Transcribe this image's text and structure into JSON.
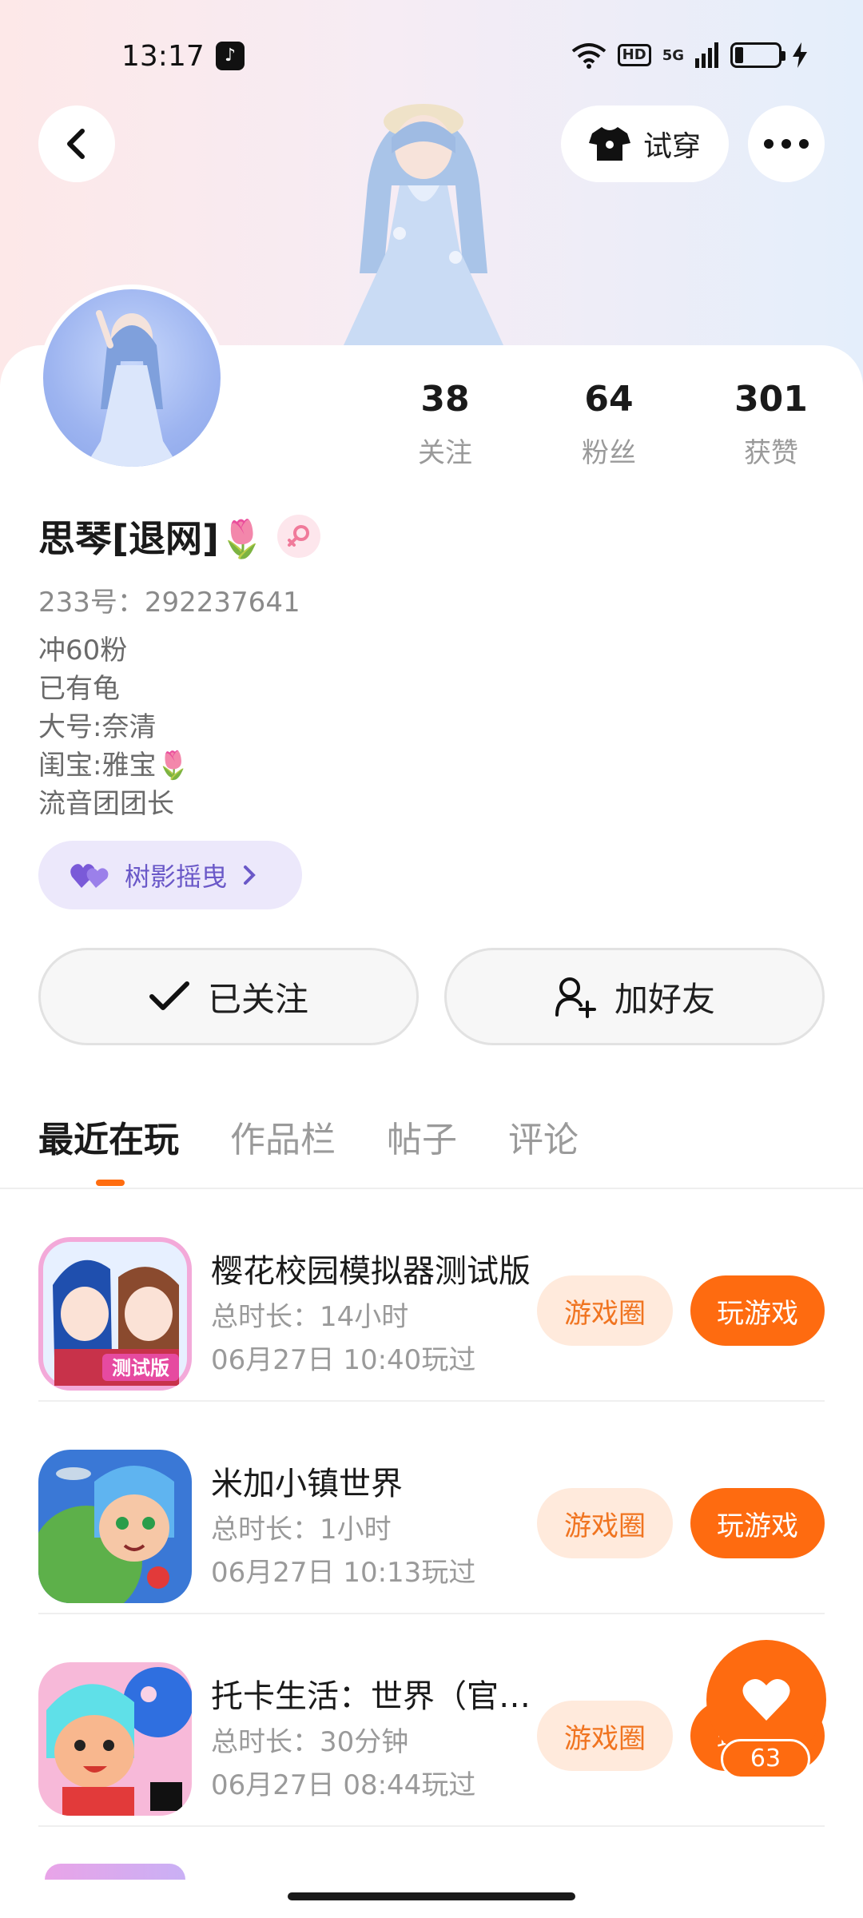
{
  "status_bar": {
    "time": "13:17",
    "network": "5G",
    "hd": "HD"
  },
  "header": {
    "tryon_label": "试穿"
  },
  "stats": [
    {
      "value": "38",
      "label": "关注"
    },
    {
      "value": "64",
      "label": "粉丝"
    },
    {
      "value": "301",
      "label": "获赞"
    }
  ],
  "profile": {
    "username": "思琴[退网]🌷",
    "id_text": "233号：292237641",
    "bio": [
      "冲60粉",
      "已有龟",
      "大号:奈清",
      "闺宝:雅宝🌷",
      "流音团团长"
    ],
    "tag_label": "树影摇曳"
  },
  "actions": {
    "followed_label": "已关注",
    "add_friend_label": "加好友"
  },
  "tabs": [
    "最近在玩",
    "作品栏",
    "帖子",
    "评论"
  ],
  "games": [
    {
      "title": "樱花校园模拟器测试版",
      "duration": "总时长：14小时",
      "last_played": "06月27日 10:40玩过",
      "circle_label": "游戏圈",
      "play_label": "玩游戏"
    },
    {
      "title": "米加小镇世界",
      "duration": "总时长：1小时",
      "last_played": "06月27日 10:13玩过",
      "circle_label": "游戏圈",
      "play_label": "玩游戏"
    },
    {
      "title": "托卡生活：世界（官方版）",
      "duration": "总时长：30分钟",
      "last_played": "06月27日 08:44玩过",
      "circle_label": "游戏圈",
      "play_label": "玩游戏"
    }
  ],
  "like": {
    "count": "63"
  },
  "colors": {
    "accent": "#fe6b10",
    "accent_light": "#ffeadc",
    "tag_bg": "#ece8fb",
    "tag_text": "#6a58c8"
  }
}
